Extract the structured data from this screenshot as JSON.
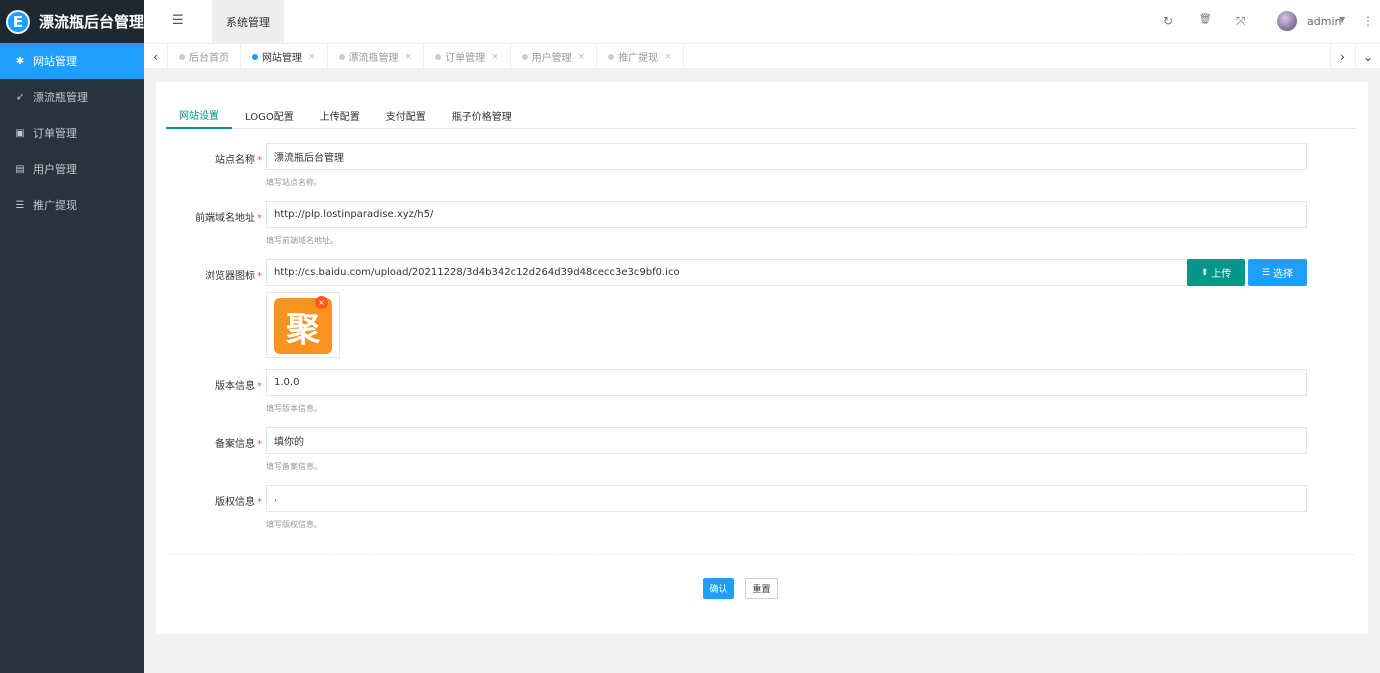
{
  "app": {
    "title": "漂流瓶后台管理",
    "logo_glyph": "E"
  },
  "sidebar": {
    "items": [
      {
        "label": "网站管理",
        "icon": "gear-icon",
        "glyph": "✱",
        "active": true
      },
      {
        "label": "漂流瓶管理",
        "icon": "rocket-icon",
        "glyph": "➶",
        "active": false
      },
      {
        "label": "订单管理",
        "icon": "calendar-check-icon",
        "glyph": "▣",
        "active": false
      },
      {
        "label": "用户管理",
        "icon": "user-card-icon",
        "glyph": "▤",
        "active": false
      },
      {
        "label": "推广提现",
        "icon": "list-icon",
        "glyph": "☰",
        "active": false
      }
    ]
  },
  "header": {
    "menu_toggle_glyph": "☰",
    "top_menu_label": "系统管理",
    "refresh_glyph": "↻",
    "trash_glyph": "🗑",
    "fullscreen_glyph": "⤧",
    "user_name": "admin",
    "caret_glyph": "▼",
    "more_glyph": "⋮"
  },
  "tabsbar": {
    "prev_glyph": "‹",
    "next_glyph": "›",
    "dropdown_glyph": "⌄",
    "close_glyph": "×",
    "tabs": [
      {
        "label": "后台首页",
        "active": false,
        "closable": false
      },
      {
        "label": "网站管理",
        "active": true,
        "closable": true
      },
      {
        "label": "漂流瓶管理",
        "active": false,
        "closable": true
      },
      {
        "label": "订单管理",
        "active": false,
        "closable": true
      },
      {
        "label": "用户管理",
        "active": false,
        "closable": true
      },
      {
        "label": "推广提现",
        "active": false,
        "closable": true
      }
    ]
  },
  "form_tabs": [
    "网站设置",
    "LOGO配置",
    "上传配置",
    "支付配置",
    "瓶子价格管理"
  ],
  "form": {
    "site_name": {
      "label": "站点名称",
      "value": "漂流瓶后台管理",
      "help": "填写站点名称。"
    },
    "frontend_domain": {
      "label": "前端域名地址",
      "value": "http://plp.lostinparadise.xyz/h5/",
      "help": "填写前端域名地址。"
    },
    "browser_icon": {
      "label": "浏览器图标",
      "value": "http://cs.baidu.com/upload/20211228/3d4b342c12d264d39d48cecc3e3c9bf0.ico",
      "upload_label": "上传",
      "select_label": "选择",
      "preview_glyph": "聚",
      "delete_glyph": "×"
    },
    "version": {
      "label": "版本信息",
      "value": "1.0.0",
      "help": "填写版本信息。"
    },
    "icp": {
      "label": "备案信息",
      "value": "填你的",
      "help": "填写备案信息。"
    },
    "copyright": {
      "label": "版权信息",
      "value": ".",
      "help": "填写版权信息。"
    },
    "required_mark": "*"
  },
  "actions": {
    "confirm_label": "确认",
    "reset_label": "重置"
  },
  "colors": {
    "sidebar_bg": "#28333e",
    "accent_blue": "#1e9fff",
    "accent_green": "#009688",
    "required_red": "#ff5722"
  }
}
